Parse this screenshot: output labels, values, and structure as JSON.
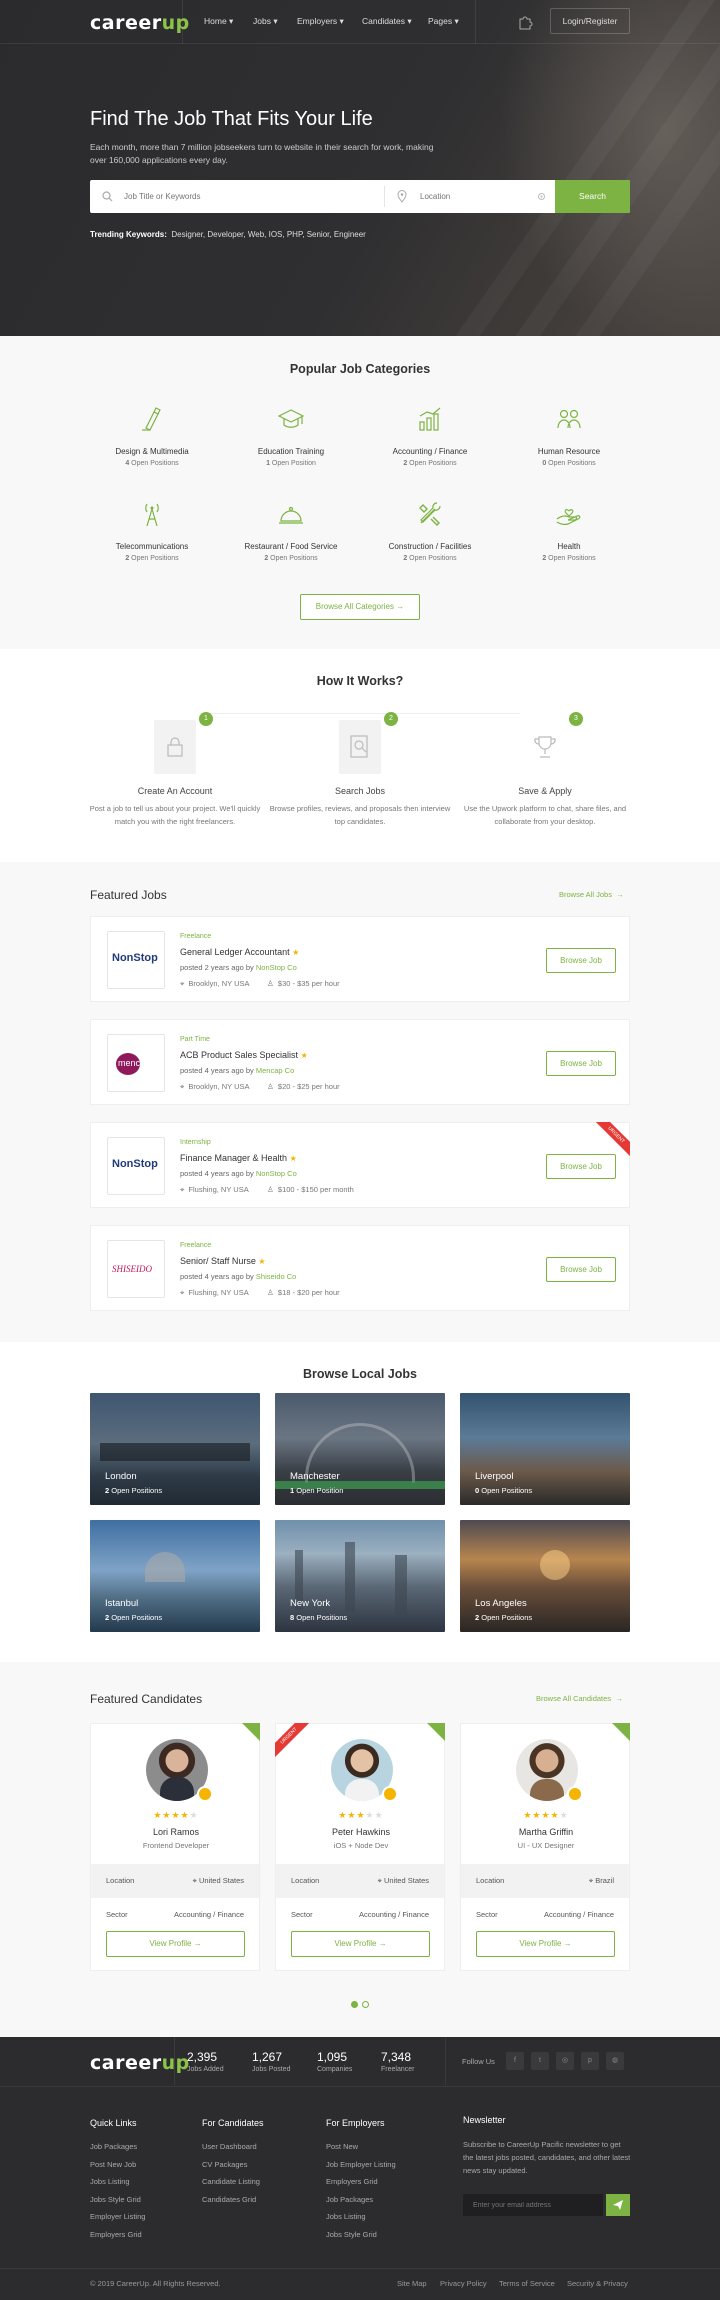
{
  "brand": {
    "logo_main": "career",
    "logo_accent": "up",
    "accent_color": "#7cb342"
  },
  "nav": {
    "items": [
      "Home",
      "Jobs",
      "Employers",
      "Candidates",
      "Pages"
    ],
    "login_label": "Login/Register"
  },
  "hero": {
    "title": "Find The Job That Fits Your Life",
    "subtitle": "Each month, more than 7 million jobseekers turn to website in their search for work, making over 160,000 applications every day.",
    "search_placeholder": "Job Title or Keywords",
    "location_placeholder": "Location",
    "search_button": "Search",
    "trending_label": "Trending Keywords:",
    "trending_keywords": "Designer,  Developer,  Web,  IOS,  PHP,  Senior,  Engineer"
  },
  "categories": {
    "title": "Popular Job Categories",
    "items": [
      {
        "name": "Design & Multimedia",
        "count": "4",
        "suffix": " Open Positions",
        "icon": "design-icon"
      },
      {
        "name": "Education Training",
        "count": "1",
        "suffix": " Open Position",
        "icon": "graduation-cap-icon"
      },
      {
        "name": "Accounting / Finance",
        "count": "2",
        "suffix": " Open Positions",
        "icon": "chart-icon"
      },
      {
        "name": "Human Resource",
        "count": "0",
        "suffix": " Open Positions",
        "icon": "people-icon"
      },
      {
        "name": "Telecommunications",
        "count": "2",
        "suffix": " Open Positions",
        "icon": "antenna-icon"
      },
      {
        "name": "Restaurant / Food Service",
        "count": "2",
        "suffix": " Open Positions",
        "icon": "cloche-icon"
      },
      {
        "name": "Construction / Facilities",
        "count": "2",
        "suffix": " Open Positions",
        "icon": "tools-icon"
      },
      {
        "name": "Health",
        "count": "2",
        "suffix": " Open Positions",
        "icon": "hand-care-icon"
      }
    ],
    "browse_all": "Browse All Categories"
  },
  "how_it_works": {
    "title": "How It Works?",
    "steps": [
      {
        "num": "1",
        "title": "Create An Account",
        "desc": "Post a job to tell us about your project. We'll quickly match you with the right freelancers."
      },
      {
        "num": "2",
        "title": "Search Jobs",
        "desc": "Browse profiles, reviews, and proposals then interview top candidates."
      },
      {
        "num": "3",
        "title": "Save & Apply",
        "desc": "Use the Upwork platform to chat, share files, and collaborate from your desktop."
      }
    ]
  },
  "featured_jobs": {
    "title": "Featured Jobs",
    "browse_all": "Browse All Jobs",
    "browse_button": "Browse Job",
    "ribbon": "URGENT",
    "jobs": [
      {
        "type": "Freelance",
        "title": "General Ledger Accountant",
        "posted": "posted 2 years ago by ",
        "company": "NonStop Co",
        "location": "Brooklyn, NY USA",
        "salary": "$30 - $35 per hour",
        "logo": "NonStop"
      },
      {
        "type": "Part Time",
        "title": "ACB Product Sales Specialist",
        "posted": "posted 4 years ago by ",
        "company": "Mencap Co",
        "location": "Brooklyn, NY USA",
        "salary": "$20 - $25 per hour",
        "logo": "mencap"
      },
      {
        "type": "Internship",
        "title": "Finance Manager & Health",
        "posted": "posted 4 years ago by ",
        "company": "NonStop Co",
        "location": "Flushing, NY USA",
        "salary": "$100 - $150 per month",
        "logo": "NonStop"
      },
      {
        "type": "Freelance",
        "title": "Senior/ Staff Nurse",
        "posted": "posted 4 years ago by ",
        "company": "Shiseido Co",
        "location": "Flushing, NY USA",
        "salary": "$18 - $20 per hour",
        "logo": "SHISEIDO"
      }
    ]
  },
  "local_jobs": {
    "title": "Browse Local Jobs",
    "cities": [
      {
        "name": "London",
        "count": "2",
        "suffix": " Open Positions"
      },
      {
        "name": "Manchester",
        "count": "1",
        "suffix": " Open Position"
      },
      {
        "name": "Liverpool",
        "count": "0",
        "suffix": " Open Positions"
      },
      {
        "name": "Istanbul",
        "count": "2",
        "suffix": " Open Positions"
      },
      {
        "name": "New York",
        "count": "8",
        "suffix": " Open Positions"
      },
      {
        "name": "Los Angeles",
        "count": "2",
        "suffix": " Open Positions"
      }
    ]
  },
  "candidates": {
    "title": "Featured Candidates",
    "browse_all": "Browse All Candidates",
    "location_label": "Location",
    "sector_label": "Sector",
    "view_profile": "View Profile",
    "ribbon": "URGENT",
    "people": [
      {
        "name": "Lori Ramos",
        "role": "Frontend Developer",
        "location": "United States",
        "sector": "Accounting / Finance",
        "rating": 4
      },
      {
        "name": "Peter Hawkins",
        "role": "iOS + Node Dev",
        "location": "United States",
        "sector": "Accounting / Finance",
        "rating": 3
      },
      {
        "name": "Martha Griffin",
        "role": "UI - UX Designer",
        "location": "Brazil",
        "sector": "Accounting / Finance",
        "rating": 4
      }
    ]
  },
  "footer": {
    "stats": [
      {
        "value": "2,395",
        "label": "Jobs Added"
      },
      {
        "value": "1,267",
        "label": "Jobs Posted"
      },
      {
        "value": "1,095",
        "label": "Companies"
      },
      {
        "value": "7,348",
        "label": "Freelancer"
      }
    ],
    "follow_label": "Follow Us",
    "quick_links": {
      "title": "Quick Links",
      "items": [
        "Job Packages",
        "Post New Job",
        "Jobs Listing",
        "Jobs Style Grid",
        "Employer Listing",
        "Employers Grid"
      ]
    },
    "for_candidates": {
      "title": "For Candidates",
      "items": [
        "User Dashboard",
        "CV Packages",
        "Candidate Listing",
        "Candidates Grid"
      ]
    },
    "for_employers": {
      "title": "For Employers",
      "items": [
        "Post New",
        "Job Employer Listing",
        "Employers Grid",
        "Job Packages",
        "Jobs Listing",
        "Jobs Style Grid"
      ]
    },
    "newsletter": {
      "title": "Newsletter",
      "text": "Subscribe to CareerUp Pacific newsletter to get the latest jobs posted, candidates, and other latest news stay updated.",
      "placeholder": "Enter your email address"
    },
    "copyright": "© 2019 CareerUp. All Rights Reserved.",
    "bottom_links": [
      "Site Map",
      "Privacy Policy",
      "Terms of Service",
      "Security & Privacy"
    ]
  }
}
